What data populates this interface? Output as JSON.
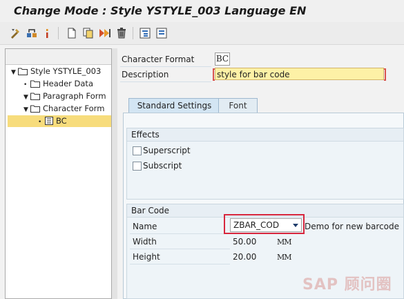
{
  "window": {
    "title": "Change Mode : Style YSTYLE_003 Language EN"
  },
  "toolbar": {
    "icons": [
      "display-change-icon",
      "switch-icon",
      "info-icon",
      "create-icon",
      "copy-icon",
      "activate-icon",
      "delete-icon",
      "expand-icon",
      "collapse-icon"
    ]
  },
  "tree": {
    "root_label": "Style YSTYLE_003",
    "items": [
      {
        "label": "Header Data"
      },
      {
        "label": "Paragraph Form"
      },
      {
        "label": "Character Form"
      },
      {
        "label": "BC"
      }
    ]
  },
  "form": {
    "char_format_label": "Character Format",
    "char_format_value": "BC",
    "description_label": "Description",
    "description_value": "style for bar code"
  },
  "tabs": [
    {
      "label": "Standard Settings",
      "active": true
    },
    {
      "label": "Font",
      "active": false
    }
  ],
  "effects": {
    "title": "Effects",
    "superscript_label": "Superscript",
    "subscript_label": "Subscript",
    "superscript_checked": false,
    "subscript_checked": false
  },
  "barcode": {
    "title": "Bar Code",
    "name_label": "Name",
    "name_value": "ZBAR_COD",
    "name_desc": "Demo for new barcode",
    "width_label": "Width",
    "width_value": "50.00",
    "width_unit": "MM",
    "height_label": "Height",
    "height_value": "20.00",
    "height_unit": "MM"
  },
  "watermark": "SAP 顾问圈",
  "colors": {
    "selection": "#f7dc7c",
    "required_border": "#d9534f",
    "highlight_box": "#d7263d",
    "tab_active": "#d3e5f3"
  }
}
